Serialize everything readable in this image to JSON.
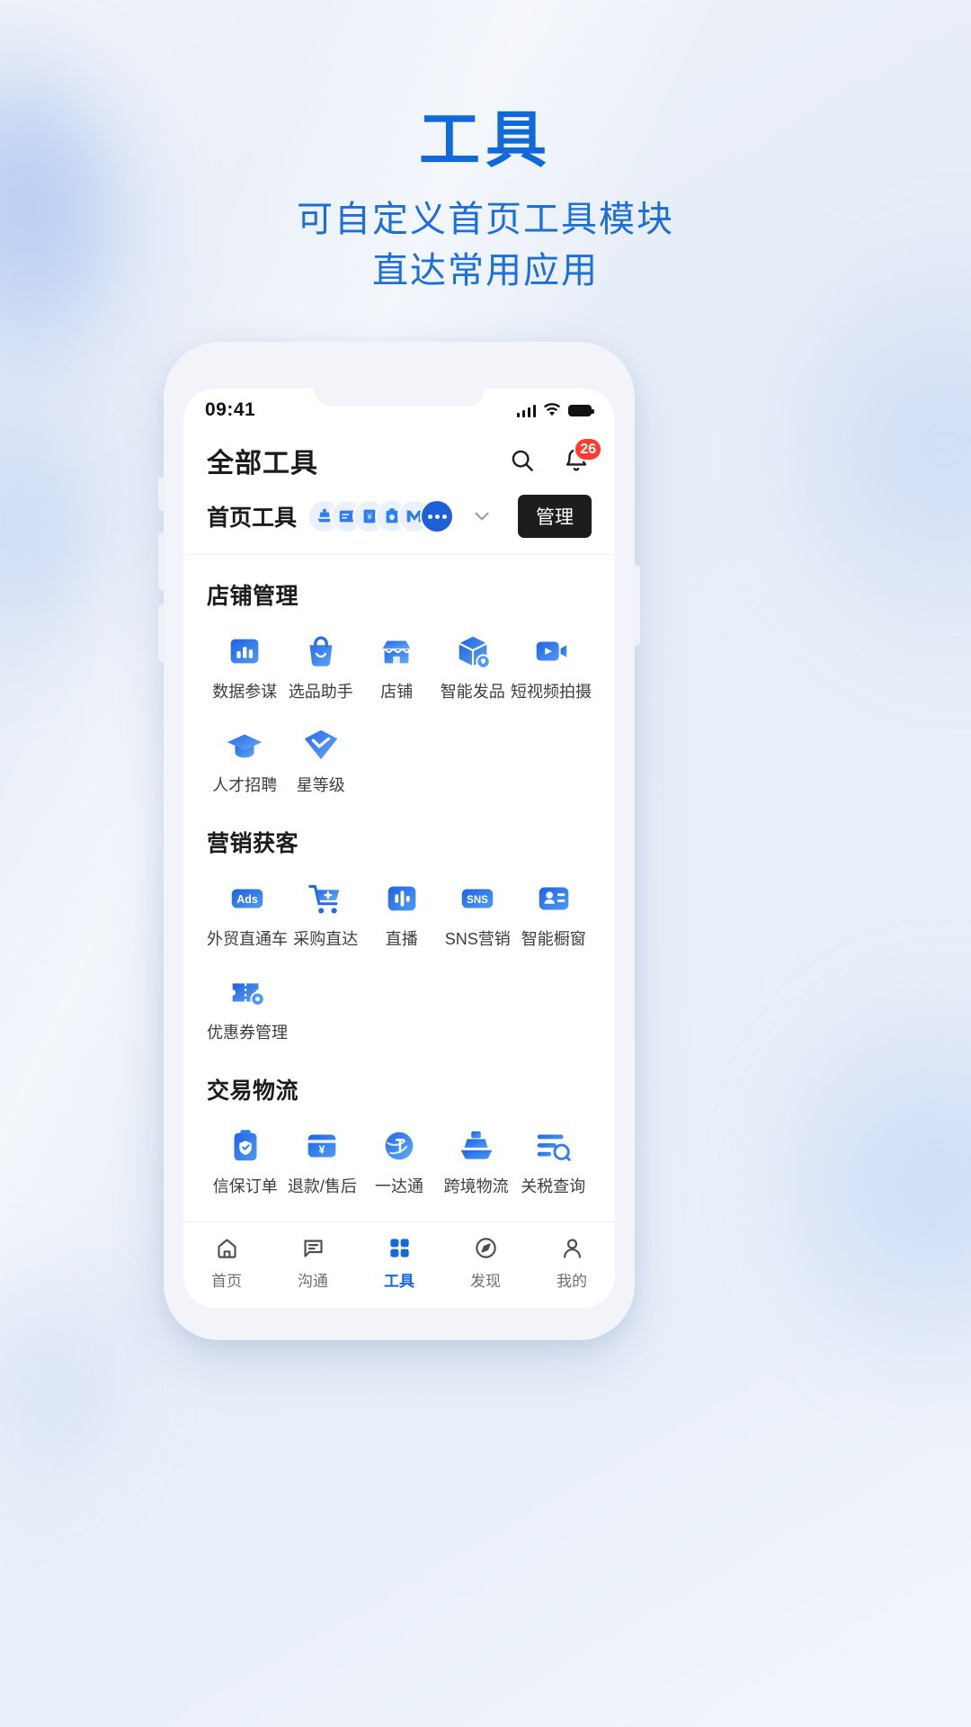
{
  "promo": {
    "title": "工具",
    "subtitle_line1": "可自定义首页工具模块",
    "subtitle_line2": "直达常用应用"
  },
  "colors": {
    "brand_blue": "#1168d9",
    "accent_blue": "#2f7ef0",
    "badge_red": "#ff3b30",
    "dark_button": "#1d1d1f"
  },
  "status_bar": {
    "time": "09:41"
  },
  "header": {
    "title": "全部工具",
    "search_icon": "search-icon",
    "bell_icon": "bell-icon",
    "notification_count": "26"
  },
  "home_tools": {
    "label": "首页工具",
    "expand_icon": "chevron-down-icon",
    "manage_label": "管理",
    "avatar_icons": [
      "ship-icon",
      "order-icon",
      "payment-icon",
      "shield-icon",
      "mail-icon"
    ],
    "more_icon": "more-dots-icon"
  },
  "sections": [
    {
      "title": "店铺管理",
      "tools": [
        {
          "label": "数据参谋",
          "icon": "bar-chart-icon"
        },
        {
          "label": "选品助手",
          "icon": "shopping-bag-icon"
        },
        {
          "label": "店铺",
          "icon": "storefront-icon"
        },
        {
          "label": "智能发品",
          "icon": "package-idea-icon"
        },
        {
          "label": "短视频拍摄",
          "icon": "video-camera-icon"
        },
        {
          "label": "人才招聘",
          "icon": "graduation-cap-icon"
        },
        {
          "label": "星等级",
          "icon": "diamond-check-icon"
        }
      ]
    },
    {
      "title": "营销获客",
      "tools": [
        {
          "label": "外贸直通车",
          "icon": "ads-icon"
        },
        {
          "label": "采购直达",
          "icon": "cart-plus-icon"
        },
        {
          "label": "直播",
          "icon": "live-broadcast-icon"
        },
        {
          "label": "SNS营销",
          "icon": "sns-icon"
        },
        {
          "label": "智能橱窗",
          "icon": "showcase-icon"
        },
        {
          "label": "优惠券管理",
          "icon": "coupon-icon"
        }
      ]
    },
    {
      "title": "交易物流",
      "tools": [
        {
          "label": "信保订单",
          "icon": "assurance-order-icon"
        },
        {
          "label": "退款/售后",
          "icon": "refund-icon"
        },
        {
          "label": "一达通",
          "icon": "yidatong-icon"
        },
        {
          "label": "跨境物流",
          "icon": "ship-logistics-icon"
        },
        {
          "label": "关税查询",
          "icon": "tariff-search-icon"
        }
      ]
    }
  ],
  "tabbar": [
    {
      "label": "首页",
      "icon": "home-icon",
      "active": false
    },
    {
      "label": "沟通",
      "icon": "chat-icon",
      "active": false
    },
    {
      "label": "工具",
      "icon": "grid-icon",
      "active": true
    },
    {
      "label": "发现",
      "icon": "compass-icon",
      "active": false
    },
    {
      "label": "我的",
      "icon": "person-icon",
      "active": false
    }
  ]
}
